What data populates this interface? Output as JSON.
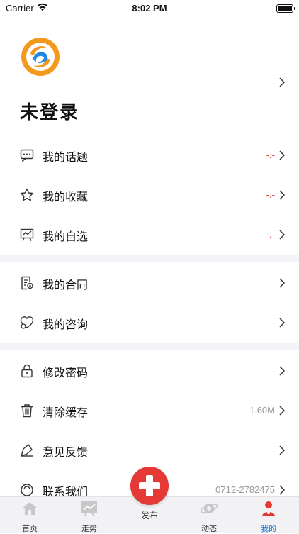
{
  "status": {
    "carrier": "Carrier",
    "time": "8:02 PM"
  },
  "profile": {
    "login_label": "未登录"
  },
  "menu": {
    "topics": {
      "label": "我的话题",
      "value": "-.-"
    },
    "favorites": {
      "label": "我的收藏",
      "value": "-.-"
    },
    "watchlist": {
      "label": "我的自选",
      "value": "-.-"
    },
    "contracts": {
      "label": "我的合同"
    },
    "consult": {
      "label": "我的咨询"
    },
    "password": {
      "label": "修改密码"
    },
    "cache": {
      "label": "清除缓存",
      "value": "1.60M"
    },
    "feedback": {
      "label": "意见反馈"
    },
    "contact": {
      "label": "联系我们",
      "value": "0712-2782475"
    }
  },
  "tabbar": {
    "home": "首页",
    "trend": "走势",
    "publish": "发布",
    "dynamic": "动态",
    "mine": "我的"
  },
  "colors": {
    "accent": "#1976d2",
    "red": "#e53935",
    "orange": "#f5a623",
    "blue": "#1e88e5"
  }
}
